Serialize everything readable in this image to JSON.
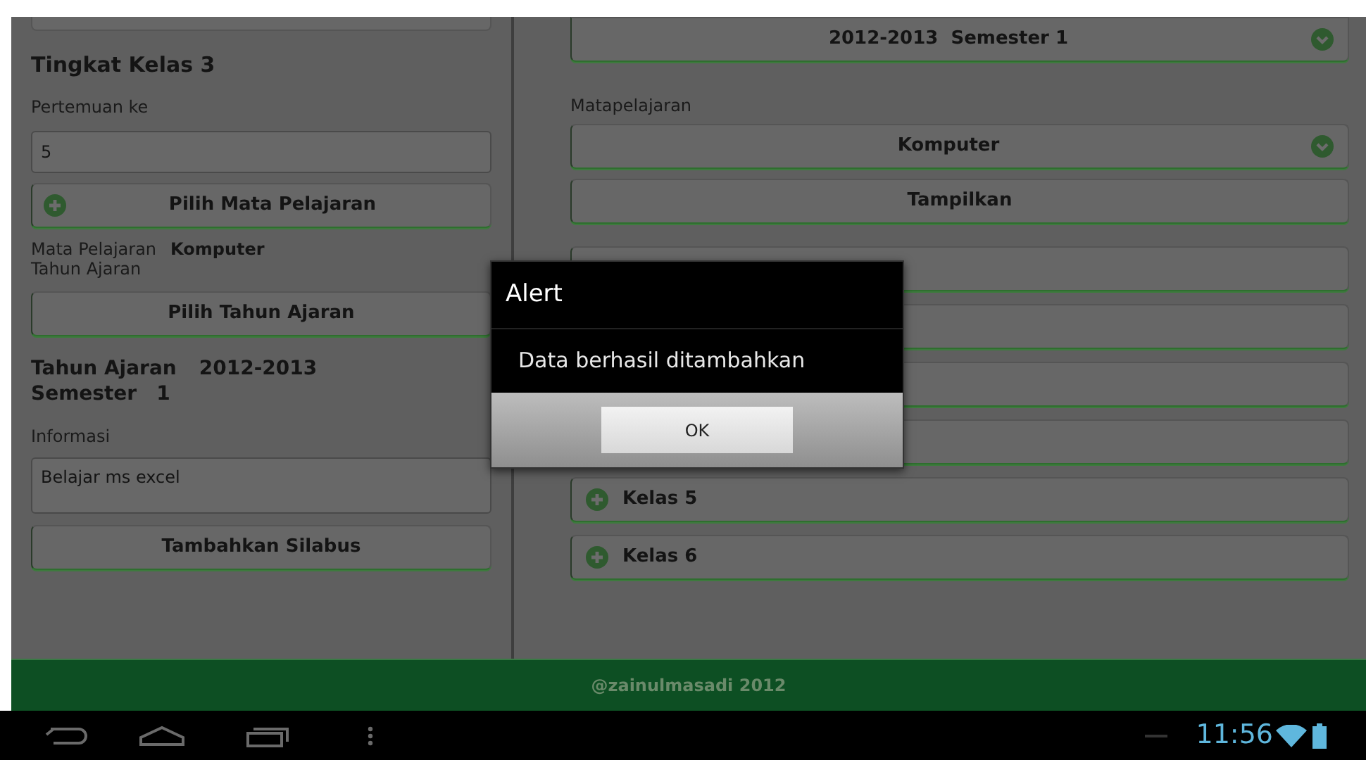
{
  "left_panel": {
    "heading": "Tingkat Kelas 3",
    "meeting_label": "Pertemuan ke",
    "meeting_value": "5",
    "subject_button": "Pilih Mata Pelajaran",
    "subject_label": "Mata Pelajaran",
    "subject_value": "Komputer",
    "year_label": "Tahun Ajaran",
    "year_button": "Pilih Tahun Ajaran",
    "summary_year_label": "Tahun Ajaran",
    "summary_year_value": "2012-2013",
    "summary_semester_label": "Semester",
    "summary_semester_value": "1",
    "info_label": "Informasi",
    "info_value": "Belajar ms excel",
    "submit_button": "Tambahkan Silabus"
  },
  "right_panel": {
    "period_select": "2012-2013  Semester 1",
    "subject_label": "Matapelajaran",
    "subject_select": "Komputer",
    "show_button": "Tampilkan",
    "class_rows": [
      {
        "label": "Kelas 5"
      },
      {
        "label": "Kelas 6"
      }
    ]
  },
  "footer": "@zainulmasadi 2012",
  "dialog": {
    "title": "Alert",
    "message": "Data berhasil ditambahkan",
    "button": "OK"
  },
  "status_bar": {
    "time": "11:56"
  }
}
